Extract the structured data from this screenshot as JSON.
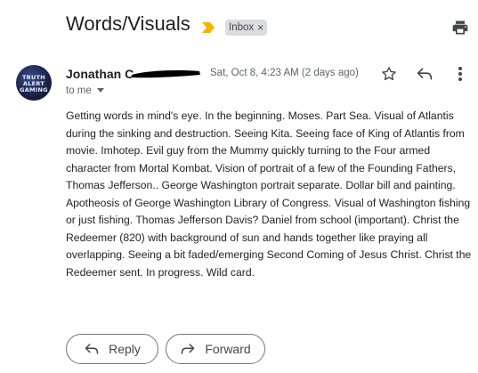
{
  "email": {
    "subject": "Words/Visuals",
    "label": "Inbox",
    "label_remove": "×",
    "sender": "Jonathan C",
    "date": "Sat, Oct 8, 4:23 AM (2 days ago)",
    "recipient": "to me",
    "avatar_text": [
      "TRUTH",
      "ALERT",
      "GAMING"
    ],
    "body": "Getting words in mind's eye. In the beginning. Moses. Part Sea. Visual of Atlantis during the sinking and destruction. Seeing Kita. Seeing face of King of Atlantis from movie. Imhotep. Evil guy from the Mummy quickly turning to the Four armed character from Mortal Kombat. Vision of portrait of a few of the Founding Fathers, Thomas Jefferson.. George Washington portrait separate. Dollar bill and painting. Apotheosis of George Washington Library of Congress. Visual of Washington fishing or just fishing. Thomas Jefferson Davis? Daniel from school (important). Christ the Redeemer (820) with background of sun and hands together like praying all overlapping. Seeing a bit faded/emerging Second Coming of Jesus Christ. Christ the Redeemer sent. In progress. Wild card."
  },
  "actions": {
    "reply": "Reply",
    "forward": "Forward"
  },
  "icons": {
    "importance": "importance-marker-icon",
    "print": "print-icon",
    "star": "star-icon",
    "reply": "reply-icon",
    "forward": "forward-icon",
    "more": "more-vert-icon"
  },
  "colors": {
    "importance": "#f4b400",
    "label_bg": "#dadce0",
    "redaction": "#000000"
  }
}
